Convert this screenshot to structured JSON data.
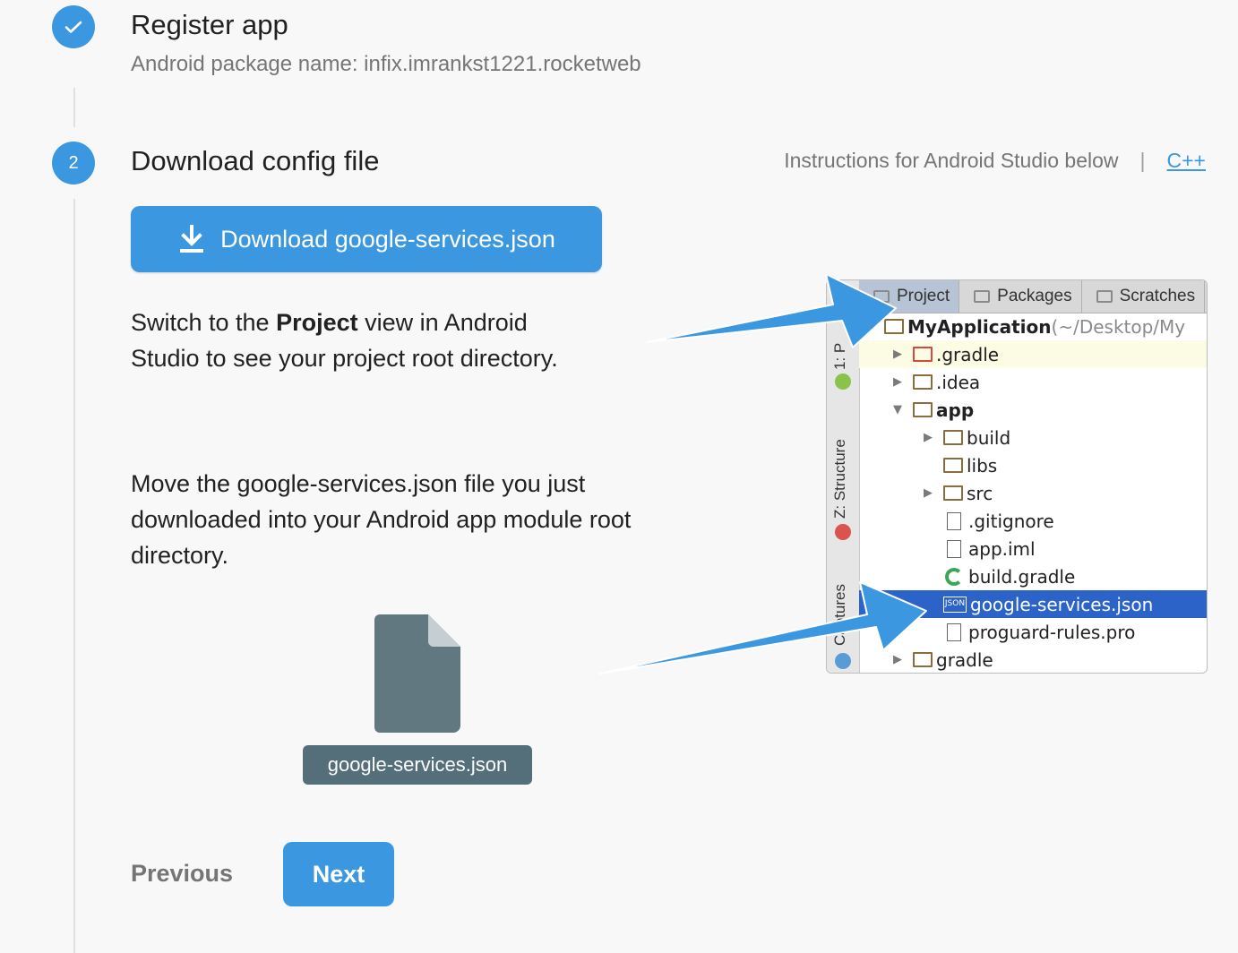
{
  "step1": {
    "title": "Register app",
    "subtitle": "Android package name: infix.imrankst1221.rocketweb",
    "status_icon": "check-icon"
  },
  "step2": {
    "number": "2",
    "title": "Download config file",
    "instructions_text": "Instructions for Android Studio below",
    "separator": "|",
    "cpp_link": "C++",
    "download_button": "Download google-services.json",
    "download_icon": "download-icon",
    "switch_text_prefix": "Switch to the ",
    "switch_text_bold": "Project",
    "switch_text_suffix": " view in Android Studio to see your project root directory.",
    "move_text": "Move the google-services.json file you just downloaded into your Android app module root directory.",
    "file_label": "google-services.json"
  },
  "ide": {
    "tabs": [
      "Project",
      "Packages",
      "Scratches"
    ],
    "side_labels": [
      "1: P",
      "Z: Structure",
      "Captures"
    ],
    "tree": [
      {
        "label": "MyApplication",
        "suffix": " (~/Desktop/My",
        "bold": true
      },
      {
        "label": ".gradle"
      },
      {
        "label": ".idea"
      },
      {
        "label": "app",
        "bold": true
      },
      {
        "label": "build"
      },
      {
        "label": "libs"
      },
      {
        "label": "src"
      },
      {
        "label": ".gitignore"
      },
      {
        "label": "app.iml"
      },
      {
        "label": "build.gradle"
      },
      {
        "label": "google-services.json",
        "json_badge": "JSON"
      },
      {
        "label": "proguard-rules.pro"
      },
      {
        "label": "gradle"
      }
    ]
  },
  "nav": {
    "previous": "Previous",
    "next": "Next"
  },
  "colors": {
    "accent": "#3b98e0",
    "chip": "#546e7a",
    "selection": "#2b63c9"
  }
}
